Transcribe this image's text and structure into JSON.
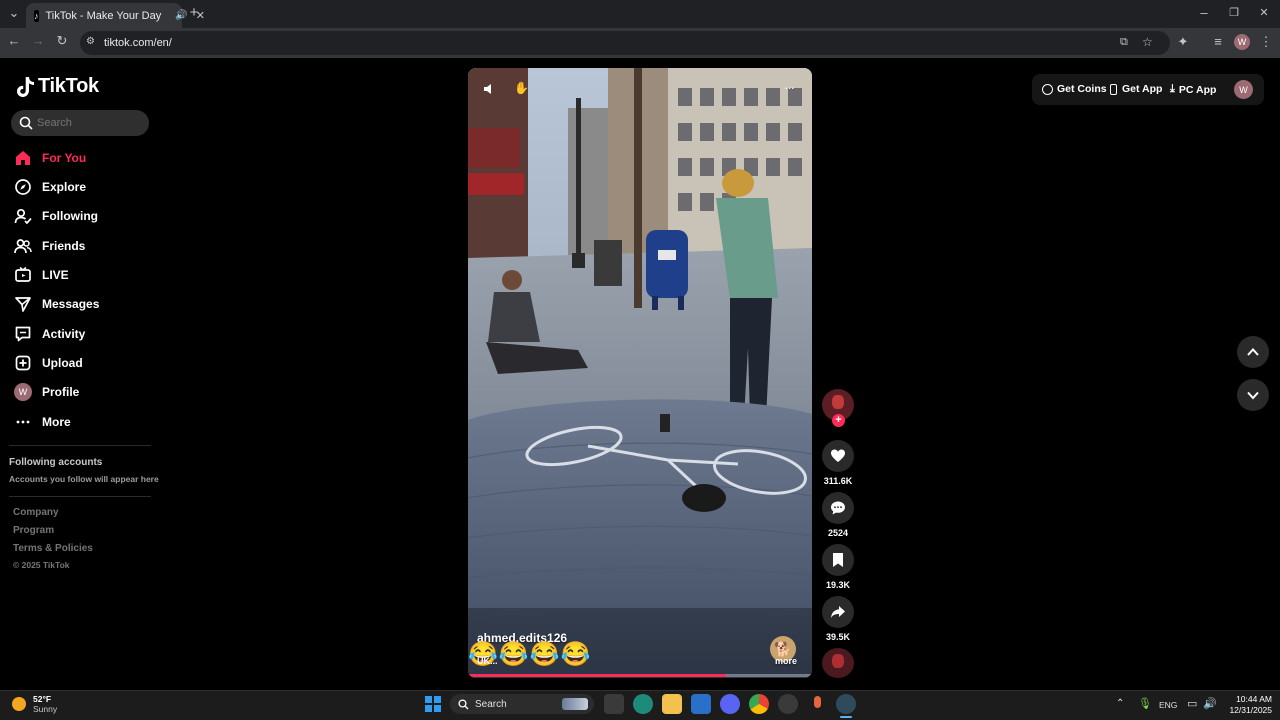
{
  "browser": {
    "tab_title": "TikTok - Make Your Day",
    "url": "tiktok.com/en/",
    "profile_initial": "W"
  },
  "sidebar": {
    "brand": "TikTok",
    "search_placeholder": "Search",
    "nav": [
      {
        "label": "For You",
        "icon": "home-icon",
        "active": true
      },
      {
        "label": "Explore",
        "icon": "compass-icon"
      },
      {
        "label": "Following",
        "icon": "following-icon"
      },
      {
        "label": "Friends",
        "icon": "friends-icon"
      },
      {
        "label": "LIVE",
        "icon": "live-icon"
      },
      {
        "label": "Messages",
        "icon": "messages-icon"
      },
      {
        "label": "Activity",
        "icon": "activity-icon"
      },
      {
        "label": "Upload",
        "icon": "upload-icon"
      },
      {
        "label": "Profile",
        "icon": "avatar",
        "avatar_initial": "W"
      },
      {
        "label": "More",
        "icon": "more-icon"
      }
    ],
    "following_title": "Following accounts",
    "following_hint": "Accounts you follow will appear here",
    "footer_links": [
      "Company",
      "Program",
      "Terms & Policies"
    ],
    "copyright": "© 2025 TikTok"
  },
  "header": {
    "get_coins": "Get Coins",
    "get_app": "Get App",
    "pc_app": "PC App",
    "profile_initial": "W"
  },
  "video": {
    "author": "ahmed.edits126",
    "caption_emoji": "😂😂😂😂",
    "caption_tag": "UK...",
    "more_label": "more",
    "progress": 0.75
  },
  "actions": {
    "likes": "311.6K",
    "comments": "2524",
    "saves": "19.3K",
    "shares": "39.5K"
  },
  "taskbar": {
    "weather_temp": "52°F",
    "weather_desc": "Sunny",
    "search_label": "Search",
    "language": "ENG",
    "time": "10:44 AM",
    "date": "12/31/2025"
  },
  "colors": {
    "accent": "#fe2c55",
    "background": "#000000",
    "chrome_dark": "#202124",
    "chrome_mid": "#35363a"
  }
}
